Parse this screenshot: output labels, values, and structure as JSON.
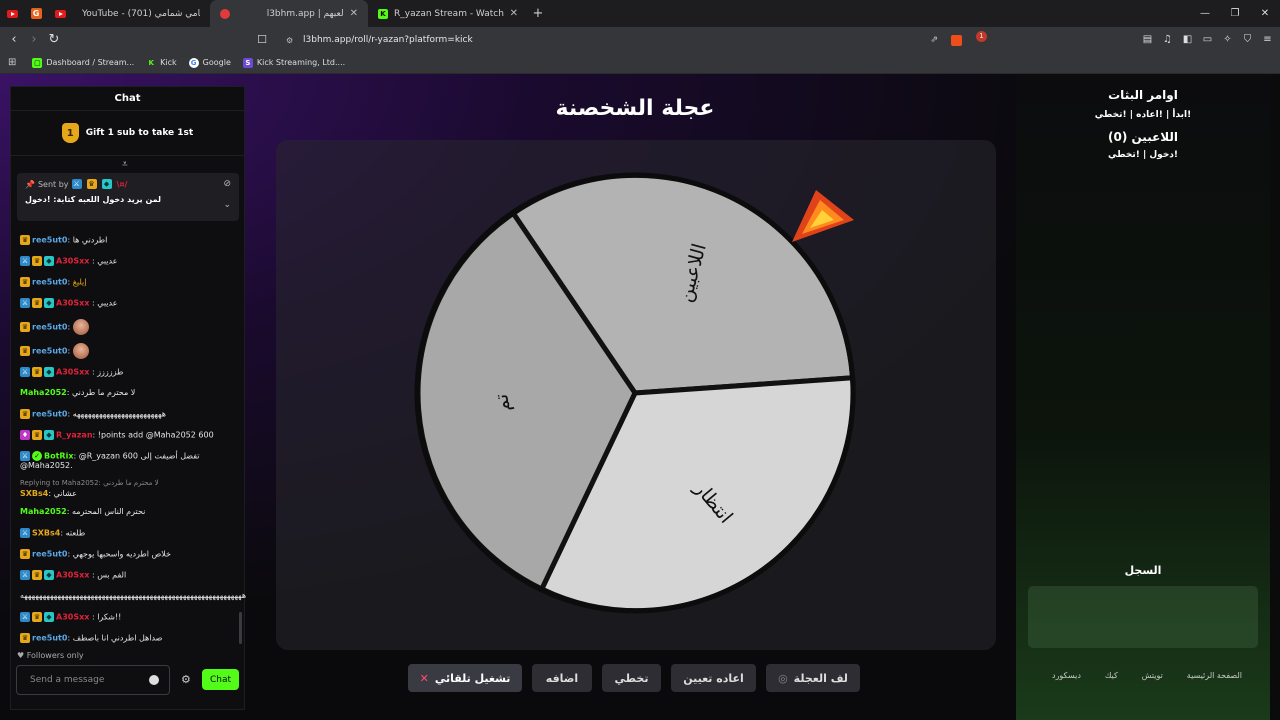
{
  "browser": {
    "tabs": [
      {
        "title": "YouTube - (701) شمامي شمامي",
        "active": false,
        "favicon": "youtube-icon",
        "color": "#e21a1a"
      },
      {
        "title": "l3bhm.app | لعبهم",
        "active": true,
        "favicon": "l3bhm-icon",
        "color": "#e03a3a"
      },
      {
        "title": "R_yazan Stream - Watch Live on Kick",
        "active": false,
        "favicon": "kick-icon",
        "color": "#53fc18"
      }
    ],
    "url": "l3bhm.app/roll/r-yazan?platform=kick",
    "extension_badge": "1",
    "bookmarks": [
      {
        "label": "Dashboard / Stream...",
        "icon": "kick-dashboard-icon"
      },
      {
        "label": "Kick",
        "icon": "kick-icon"
      },
      {
        "label": "Google",
        "icon": "google-icon"
      },
      {
        "label": "Kick Streaming, Ltd....",
        "icon": "kick-streaming-icon"
      }
    ]
  },
  "chat": {
    "header": "Chat",
    "gift_text": "Gift 1 sub to take 1st",
    "gift_rank": "1",
    "pinned": {
      "sent_by": "Sent by",
      "author": "\\¤/",
      "text": "لمن يريد دخول اللعبه كتابة: !دخول"
    },
    "messages": [
      {
        "user": "ree5ut0",
        "color": "#5aa8e6",
        "sep": ": ",
        "text": "اطردني ها",
        "badges": [
          "crown"
        ]
      },
      {
        "user": "A30Sxx",
        "color": "#e0223a",
        "sep": " : ",
        "text": "عديبي",
        "badges": [
          "mod",
          "crown",
          "sub"
        ]
      },
      {
        "user": "ree5ut0",
        "color": "#5aa8e6",
        "sep": ": ",
        "text": "إيليغ",
        "badges": [
          "crown"
        ],
        "text_color": "#e5a81a"
      },
      {
        "user": "A30Sxx",
        "color": "#e0223a",
        "sep": " : ",
        "text": "عديبي",
        "badges": [
          "mod",
          "crown",
          "sub"
        ]
      },
      {
        "user": "ree5ut0",
        "color": "#5aa8e6",
        "sep": ": ",
        "text": "",
        "badges": [
          "crown"
        ],
        "emote": true
      },
      {
        "user": "ree5ut0",
        "color": "#5aa8e6",
        "sep": ": ",
        "text": "",
        "badges": [
          "crown"
        ],
        "emote": true
      },
      {
        "user": "A30Sxx",
        "color": "#e0223a",
        "sep": " : ",
        "text": "طززززز",
        "badges": [
          "mod",
          "crown",
          "sub"
        ]
      },
      {
        "user": "Maha2052",
        "color": "#53fc18",
        "sep": ": ",
        "text": "لا محترم ما طردني",
        "badges": []
      },
      {
        "user": "ree5ut0",
        "color": "#5aa8e6",
        "sep": ": ",
        "text": "ههههههههههههههههههههههههه",
        "badges": [
          "crown"
        ]
      },
      {
        "user": "R_yazan",
        "color": "#e0223a",
        "sep": ": ",
        "text": "!points add @Maha2052 600",
        "badges": [
          "vip",
          "crown",
          "sub"
        ]
      },
      {
        "user": "BotRix",
        "color": "#53fc18",
        "sep": ": ",
        "text": "@R_yazan 600 تفضل أضيفت إلى @Maha2052.",
        "badges": [
          "mod",
          "verified"
        ]
      },
      {
        "reply_to": "Replying to Maha2052: لا محترم ما طردني",
        "user": "SXBs4",
        "color": "#e5a81a",
        "sep": ": ",
        "text": "عشاني",
        "badges": []
      },
      {
        "user": "Maha2052",
        "color": "#53fc18",
        "sep": ": ",
        "text": "نحترم الناس المحترمه",
        "badges": []
      },
      {
        "user": "SXBs4",
        "color": "#e5a81a",
        "sep": ": ",
        "text": "طلعته",
        "badges": [
          "mod"
        ]
      },
      {
        "user": "ree5ut0",
        "color": "#5aa8e6",
        "sep": ": ",
        "text": "خلاص اطرديه واسحبها يوجهي",
        "badges": [
          "crown"
        ]
      },
      {
        "user": "A30Sxx",
        "color": "#e0223a",
        "sep": " : ",
        "text": "الفم بس",
        "badges": [
          "mod",
          "crown",
          "sub"
        ]
      },
      {
        "user": "",
        "color": "#fff",
        "sep": "",
        "text": "ههههههههههههههههههههههههههههههههههههههههههههههههههههههههههههه",
        "badges": []
      },
      {
        "user": "A30Sxx",
        "color": "#e0223a",
        "sep": " : ",
        "text": "شكرا!!",
        "badges": [
          "mod",
          "crown",
          "sub"
        ]
      },
      {
        "user": "ree5ut0",
        "color": "#5aa8e6",
        "sep": ": ",
        "text": "صداهل اطردني انا باصطف",
        "badges": [
          "crown"
        ]
      }
    ],
    "followers_only": "Followers only",
    "input_placeholder": "Send a message",
    "send_label": "Chat"
  },
  "wheel": {
    "title": "عجلة الشخصنة",
    "segments": [
      "اللاعبين",
      "انتظار",
      "تم"
    ],
    "segment_colors": [
      "#b3b3b3",
      "#d6d6d6",
      "#a8a8a8"
    ],
    "pointer_icon": "fire-pointer-icon"
  },
  "controls": {
    "auto_play": "تشغيل تلقائي",
    "add": "اضافه",
    "skip": "تخطي",
    "reset": "اعاده تعيين",
    "spin": "لف العجلة"
  },
  "side": {
    "commands_title": "اوامر البثات",
    "commands_line": "!ابدأ | !اعاده | !تخطي",
    "players_title": "اللاعبين (0)",
    "players_line": "!دخول | !تخطي",
    "log_title": "السجل",
    "footer": [
      "الصفحة الرئيسية",
      "تويتش",
      "كيك",
      "ديسكورد"
    ]
  }
}
